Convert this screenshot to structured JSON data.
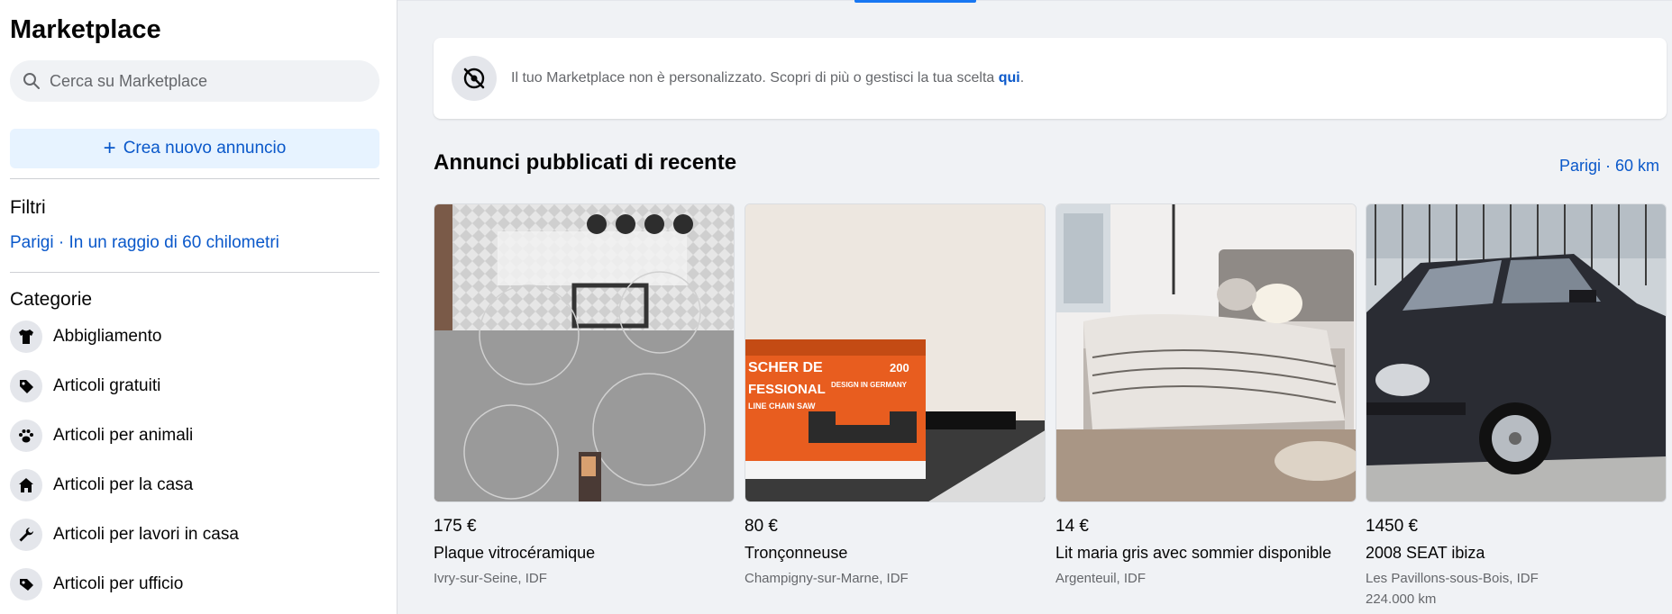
{
  "sidebar": {
    "title": "Marketplace",
    "search_placeholder": "Cerca su Marketplace",
    "create_label": "Crea nuovo annuncio",
    "filters_heading": "Filtri",
    "filter_location": "Parigi · In un raggio di 60 chilometri",
    "categories_heading": "Categorie",
    "categories": [
      {
        "label": "Abbigliamento",
        "icon": "shirt-icon"
      },
      {
        "label": "Articoli gratuiti",
        "icon": "tag-icon"
      },
      {
        "label": "Articoli per animali",
        "icon": "paw-icon"
      },
      {
        "label": "Articoli per la casa",
        "icon": "home-icon"
      },
      {
        "label": "Articoli per lavori in casa",
        "icon": "wrench-icon"
      },
      {
        "label": "Articoli per ufficio",
        "icon": "office-tag-icon"
      }
    ]
  },
  "notice": {
    "text": "Il tuo Marketplace non è personalizzato. Scopri di più o gestisci la tua scelta ",
    "link": "qui",
    "end": "."
  },
  "feed": {
    "title": "Annunci pubblicati di recente",
    "location": "Parigi · 60 km"
  },
  "listings": [
    {
      "price": "175 €",
      "title": "Plaque vitrocéramique",
      "location": "Ivry-sur-Seine, IDF",
      "extra": ""
    },
    {
      "price": "80 €",
      "title": "Tronçonneuse",
      "location": "Champigny-sur-Marne, IDF",
      "extra": ""
    },
    {
      "price": "14 €",
      "title": "Lit maria gris avec sommier disponible",
      "location": "Argenteuil, IDF",
      "extra": ""
    },
    {
      "price": "1450 €",
      "title": "2008 SEAT ibiza",
      "location": "Les Pavillons-sous-Bois, IDF",
      "extra": "224.000 km"
    }
  ],
  "photo_text": {
    "saw_brand": "SCHER DE",
    "saw_line2": "FESSIONAL",
    "saw_line3": "LINE CHAIN SAW",
    "saw_design": "DESIGN IN GERMANY",
    "saw_model": "200"
  },
  "colors": {
    "accent": "#1877f2",
    "link": "#0a58ca",
    "background": "#f0f2f5"
  }
}
